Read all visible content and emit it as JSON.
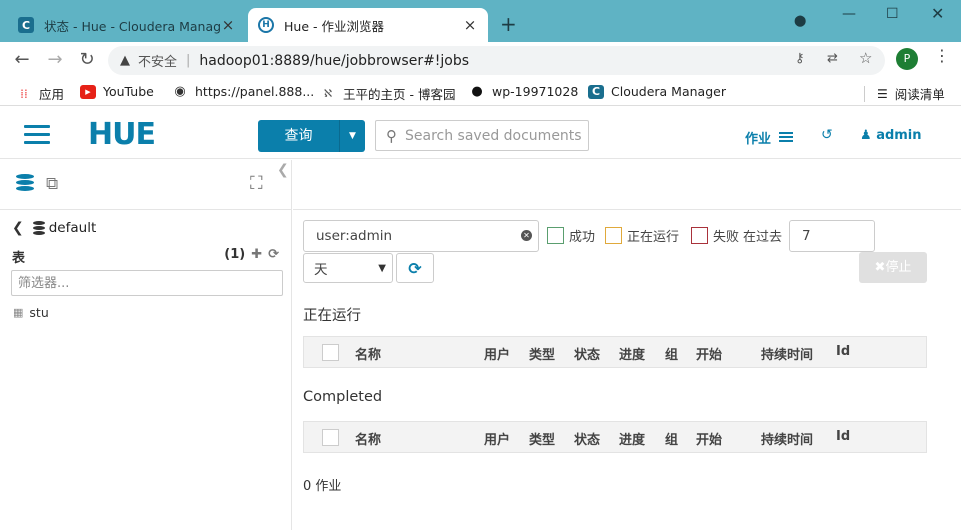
{
  "browser": {
    "tabs": [
      {
        "favicon": "C",
        "title": "状态 - Hue - Cloudera Manage",
        "close": "×"
      },
      {
        "favicon": "H",
        "title": "Hue - 作业浏览器",
        "close": "×"
      }
    ],
    "new_tab": "+",
    "address": {
      "security_label": "不安全",
      "url": "hadoop01:8889/hue/jobbrowser#!jobs"
    },
    "profile_initial": "P",
    "bookmarks": [
      {
        "icon": "apps-grid-icon",
        "label": "应用"
      },
      {
        "icon": "youtube-icon",
        "label": "YouTube"
      },
      {
        "icon": "globe-icon",
        "label": "https://panel.888..."
      },
      {
        "icon": "blog-icon",
        "label": "王平的主页 - 博客园"
      },
      {
        "icon": "github-icon",
        "label": "wp-19971028"
      },
      {
        "icon": "cloudera-icon",
        "label": "Cloudera Manager"
      }
    ],
    "reading_list": "阅读清单"
  },
  "hue": {
    "logo": "HUE",
    "query_button": "查询",
    "search_placeholder": "Search saved documents...",
    "jobs_link": "作业",
    "user": "admin"
  },
  "left_panel": {
    "database": "default",
    "tables_label": "表",
    "tables_count": "(1)",
    "filter_placeholder": "筛选器...",
    "tables": [
      "stu"
    ]
  },
  "main": {
    "filter_value": "user:admin",
    "statuses": [
      {
        "label": "成功",
        "color": "#5a9e6f"
      },
      {
        "label": "正在运行",
        "color": "#e0a93b"
      },
      {
        "label": "失败",
        "color": "#a9323b"
      }
    ],
    "in_the_past": "在过去",
    "days_value": "7",
    "unit_value": "天",
    "stop_button": "✖停止",
    "running_section": "正在运行",
    "completed_section": "Completed",
    "columns": [
      "名称",
      "用户",
      "类型",
      "状态",
      "进度",
      "组",
      "开始",
      "持续时间",
      "Id"
    ],
    "jobs_count": "0 作业"
  },
  "colors": {
    "accent": "#0b7fab",
    "tabstrip": "#5fb3c4"
  }
}
